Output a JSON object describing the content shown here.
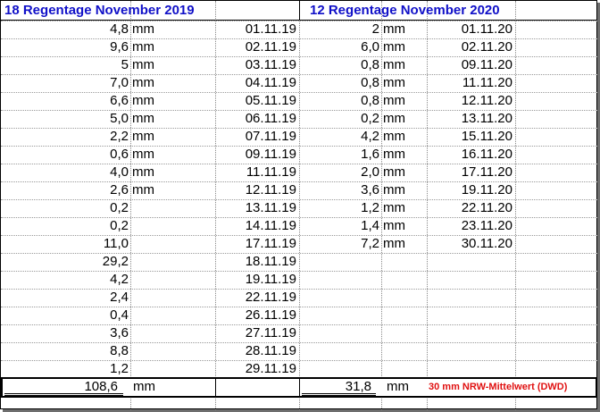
{
  "header": {
    "left": "18 Regentage November 2019",
    "right": "12 Regentage November 2020"
  },
  "unit": "mm",
  "rows2019": [
    {
      "value": "4,8",
      "unit": "mm",
      "date": "01.11.19"
    },
    {
      "value": "9,6",
      "unit": "mm",
      "date": "02.11.19"
    },
    {
      "value": "5",
      "unit": "mm",
      "date": "03.11.19"
    },
    {
      "value": "7,0",
      "unit": "mm",
      "date": "04.11.19"
    },
    {
      "value": "6,6",
      "unit": "mm",
      "date": "05.11.19"
    },
    {
      "value": "5,0",
      "unit": "mm",
      "date": "06.11.19"
    },
    {
      "value": "2,2",
      "unit": "mm",
      "date": "07.11.19"
    },
    {
      "value": "0,6",
      "unit": "mm",
      "date": "09.11.19"
    },
    {
      "value": "4,0",
      "unit": "mm",
      "date": "11.11.19"
    },
    {
      "value": "2,6",
      "unit": "mm",
      "date": "12.11.19"
    },
    {
      "value": "0,2",
      "unit": "",
      "date": "13.11.19"
    },
    {
      "value": "0,2",
      "unit": "",
      "date": "14.11.19"
    },
    {
      "value": "11,0",
      "unit": "",
      "date": "17.11.19"
    },
    {
      "value": "29,2",
      "unit": "",
      "date": "18.11.19"
    },
    {
      "value": "4,2",
      "unit": "",
      "date": "19.11.19"
    },
    {
      "value": "2,4",
      "unit": "",
      "date": "22.11.19"
    },
    {
      "value": "0,4",
      "unit": "",
      "date": "26.11.19"
    },
    {
      "value": "3,6",
      "unit": "",
      "date": "27.11.19"
    },
    {
      "value": "8,8",
      "unit": "",
      "date": "28.11.19"
    },
    {
      "value": "1,2",
      "unit": "",
      "date": "29.11.19"
    }
  ],
  "rows2020": [
    {
      "value": "2",
      "unit": "mm",
      "date": "01.11.20"
    },
    {
      "value": "6,0",
      "unit": "mm",
      "date": "02.11.20"
    },
    {
      "value": "0,8",
      "unit": "mm",
      "date": "09.11.20"
    },
    {
      "value": "0,8",
      "unit": "mm",
      "date": "11.11.20"
    },
    {
      "value": "0,8",
      "unit": "mm",
      "date": "12.11.20"
    },
    {
      "value": "0,2",
      "unit": "mm",
      "date": "13.11.20"
    },
    {
      "value": "4,2",
      "unit": "mm",
      "date": "15.11.20"
    },
    {
      "value": "1,6",
      "unit": "mm",
      "date": "16.11.20"
    },
    {
      "value": "2,0",
      "unit": "mm",
      "date": "17.11.20"
    },
    {
      "value": "3,6",
      "unit": "mm",
      "date": "19.11.20"
    },
    {
      "value": "1,2",
      "unit": "mm",
      "date": "22.11.20"
    },
    {
      "value": "1,4",
      "unit": "mm",
      "date": "23.11.20"
    },
    {
      "value": "7,2",
      "unit": "mm",
      "date": "30.11.20"
    }
  ],
  "totals": {
    "left_value": "108,6",
    "left_unit": "mm",
    "right_value": "31,8",
    "right_unit": "mm",
    "note": "30 mm NRW-Mittelwert (DWD)"
  },
  "colors": {
    "header": "#1010c8",
    "note": "#e01010"
  }
}
